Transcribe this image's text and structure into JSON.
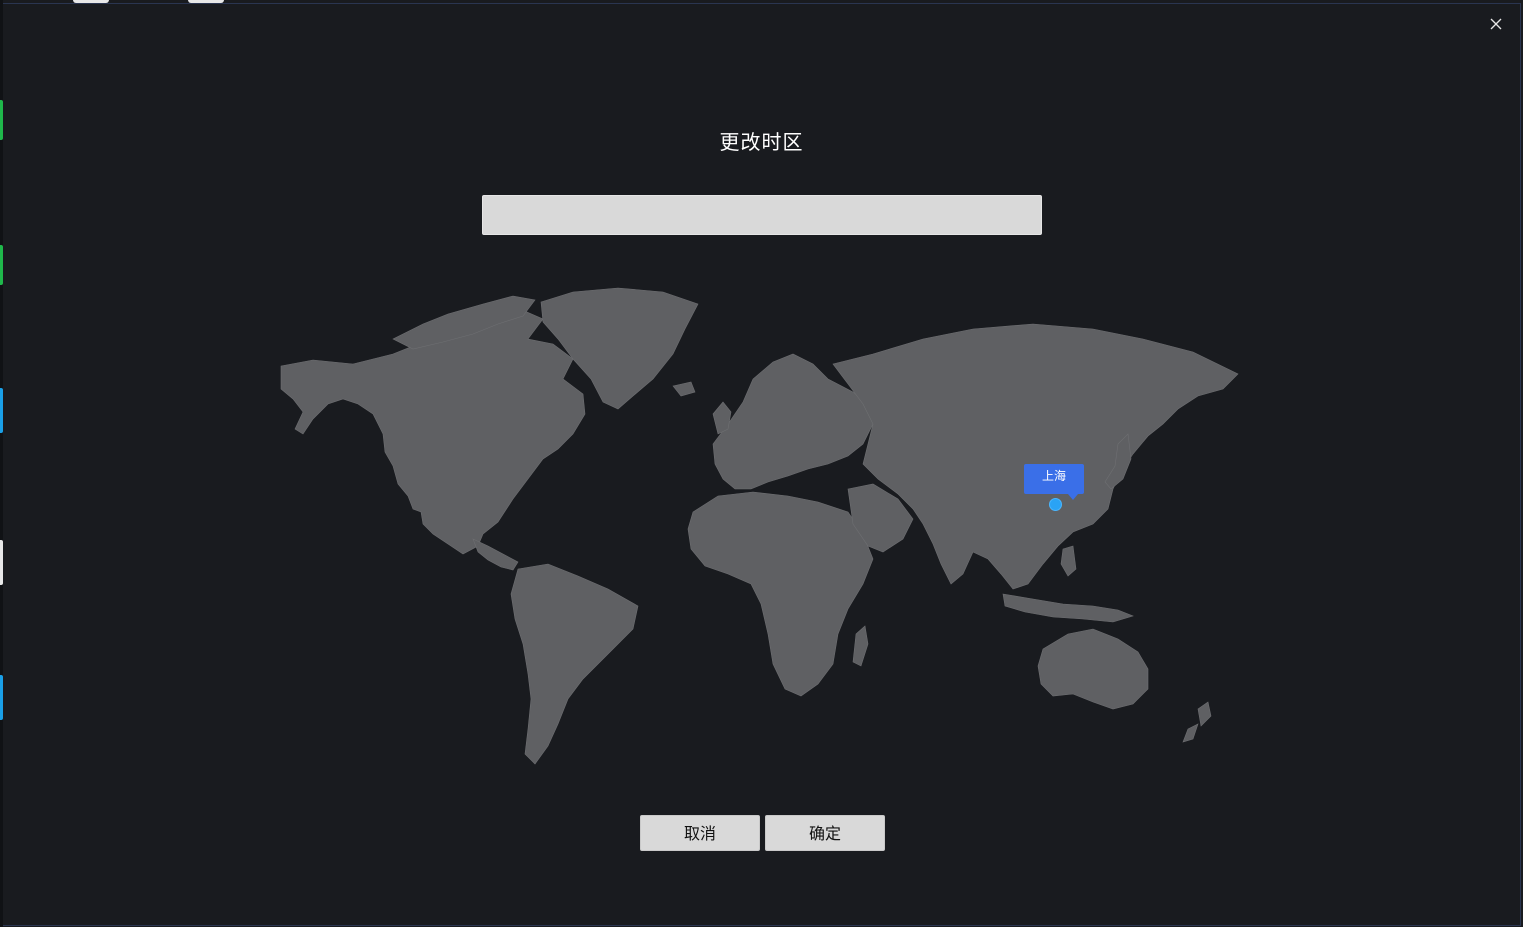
{
  "dialog": {
    "title": "更改时区",
    "close_icon": "close-icon"
  },
  "search": {
    "value": "",
    "placeholder": ""
  },
  "map": {
    "selected_city": "上海"
  },
  "buttons": {
    "cancel_label": "取消",
    "confirm_label": "确定"
  },
  "colors": {
    "background": "#191b1f",
    "land": "#5f6063",
    "label_bg": "#3a6fe8",
    "pin": "#2aa3f5",
    "button_bg": "#d9d9d9"
  }
}
